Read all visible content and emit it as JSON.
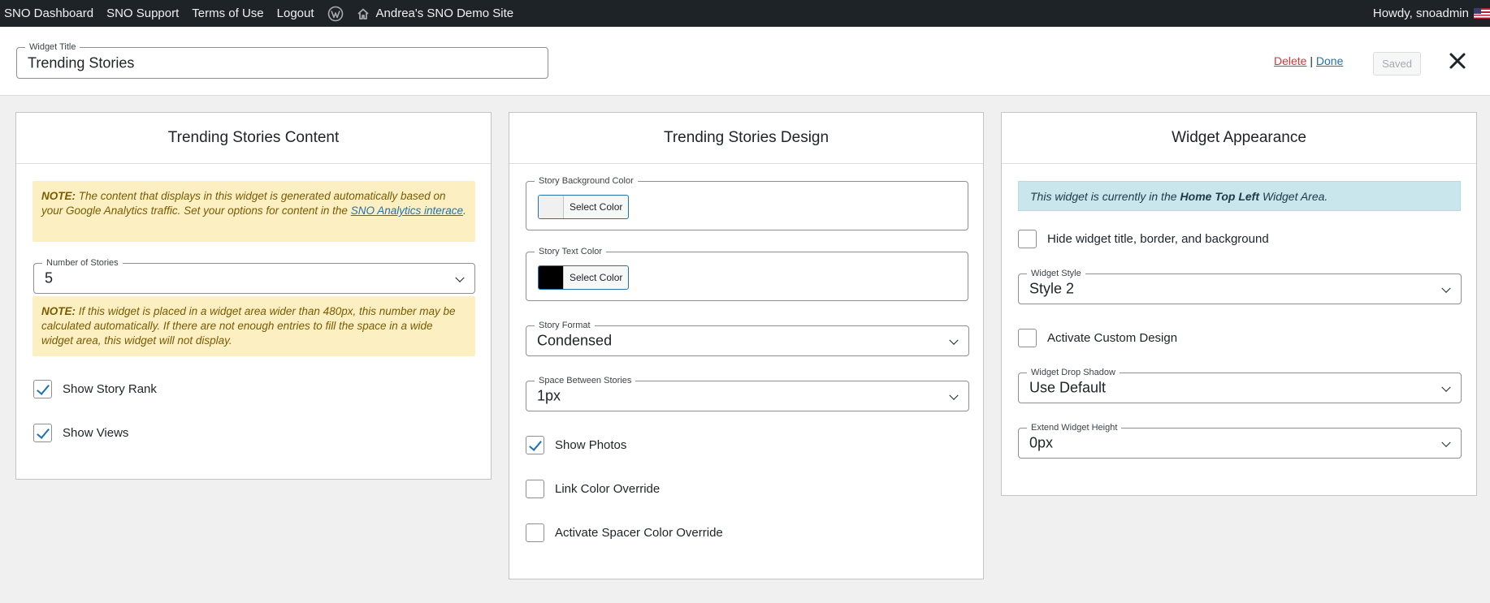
{
  "adminbar": {
    "items": [
      "SNO Dashboard",
      "SNO Support",
      "Terms of Use",
      "Logout"
    ],
    "site_name": "Andrea's SNO Demo Site",
    "howdy": "Howdy, snoadmin"
  },
  "header": {
    "title_legend": "Widget Title",
    "title_value": "Trending Stories",
    "delete_label": "Delete",
    "separator": "|",
    "done_label": "Done",
    "saved_label": "Saved"
  },
  "content_panel": {
    "heading": "Trending Stories Content",
    "note1_label": "NOTE:",
    "note1_text": "The content that displays in this widget is generated automatically based on your Google Analytics traffic. Set your options for content in the",
    "note1_link": "SNO Analytics interace",
    "note1_end": ".",
    "stories_legend": "Number of Stories",
    "stories_value": "5",
    "note2_label": "NOTE:",
    "note2_text": "If this widget is placed in a widget area wider than 480px, this number may be calculated automatically. If there are not enough entries to fill the space in a wide widget area, this widget will not display.",
    "show_rank_label": "Show Story Rank",
    "show_rank_checked": true,
    "show_views_label": "Show Views",
    "show_views_checked": true
  },
  "design_panel": {
    "heading": "Trending Stories Design",
    "bg_color_legend": "Story Background Color",
    "bg_color_value": "#f0f0f1",
    "select_color_label": "Select Color",
    "text_color_legend": "Story Text Color",
    "text_color_value": "#000000",
    "format_legend": "Story Format",
    "format_value": "Condensed",
    "space_legend": "Space Between Stories",
    "space_value": "1px",
    "show_photos_label": "Show Photos",
    "show_photos_checked": true,
    "link_override_label": "Link Color Override",
    "link_override_checked": false,
    "spacer_override_label": "Activate Spacer Color Override",
    "spacer_override_checked": false
  },
  "appearance_panel": {
    "heading": "Widget Appearance",
    "info_pre": "This widget is currently in the",
    "info_area": "Home Top Left",
    "info_post": "Widget Area.",
    "hide_title_label": "Hide widget title, border, and background",
    "hide_title_checked": false,
    "style_legend": "Widget Style",
    "style_value": "Style 2",
    "custom_design_label": "Activate Custom Design",
    "custom_design_checked": false,
    "shadow_legend": "Widget Drop Shadow",
    "shadow_value": "Use Default",
    "extend_legend": "Extend Widget Height",
    "extend_value": "0px"
  },
  "colors": {
    "adminbar_bg": "#1d2327",
    "link_blue": "#2271b1",
    "delete_red": "#d63638",
    "note_bg": "#fcf0c3",
    "info_bg": "#c9e6ed"
  }
}
